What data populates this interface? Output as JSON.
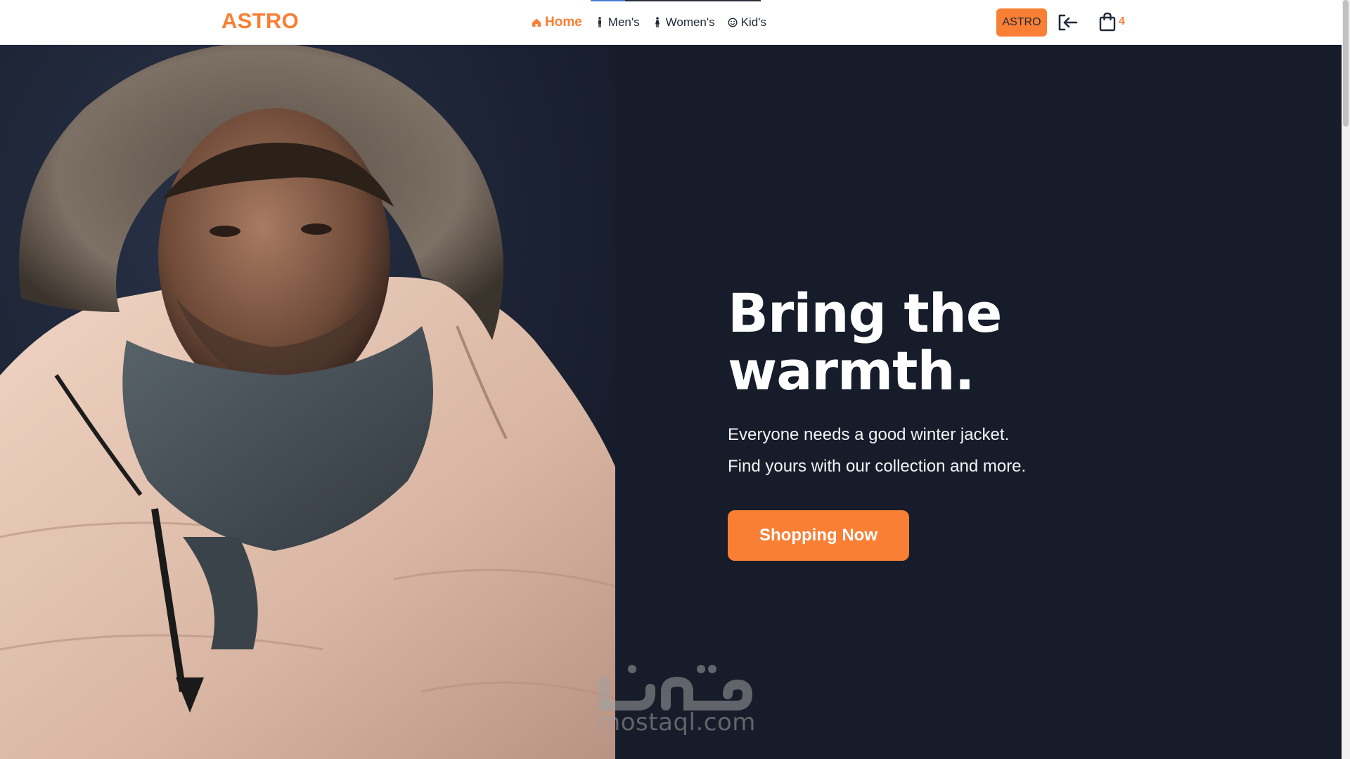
{
  "header": {
    "brand": "ASTRO",
    "nav": [
      {
        "label": "Home",
        "icon": "home-icon",
        "active": true
      },
      {
        "label": "Men's",
        "icon": "man-icon",
        "active": false
      },
      {
        "label": "Women's",
        "icon": "woman-icon",
        "active": false
      },
      {
        "label": "Kid's",
        "icon": "smiley-icon",
        "active": false
      }
    ],
    "button_label": "ASTRO",
    "cart_count": "4"
  },
  "hero": {
    "headline": "Bring the warmth.",
    "subtitle_line1": "Everyone needs a good winter jacket.",
    "subtitle_line2": "Find yours with our collection and more.",
    "cta_label": "Shopping Now"
  },
  "watermark": {
    "text": "mostaql.com"
  },
  "colors": {
    "accent": "#f97f35",
    "hero_background": "#171c2a",
    "header_background": "#ffffff"
  }
}
